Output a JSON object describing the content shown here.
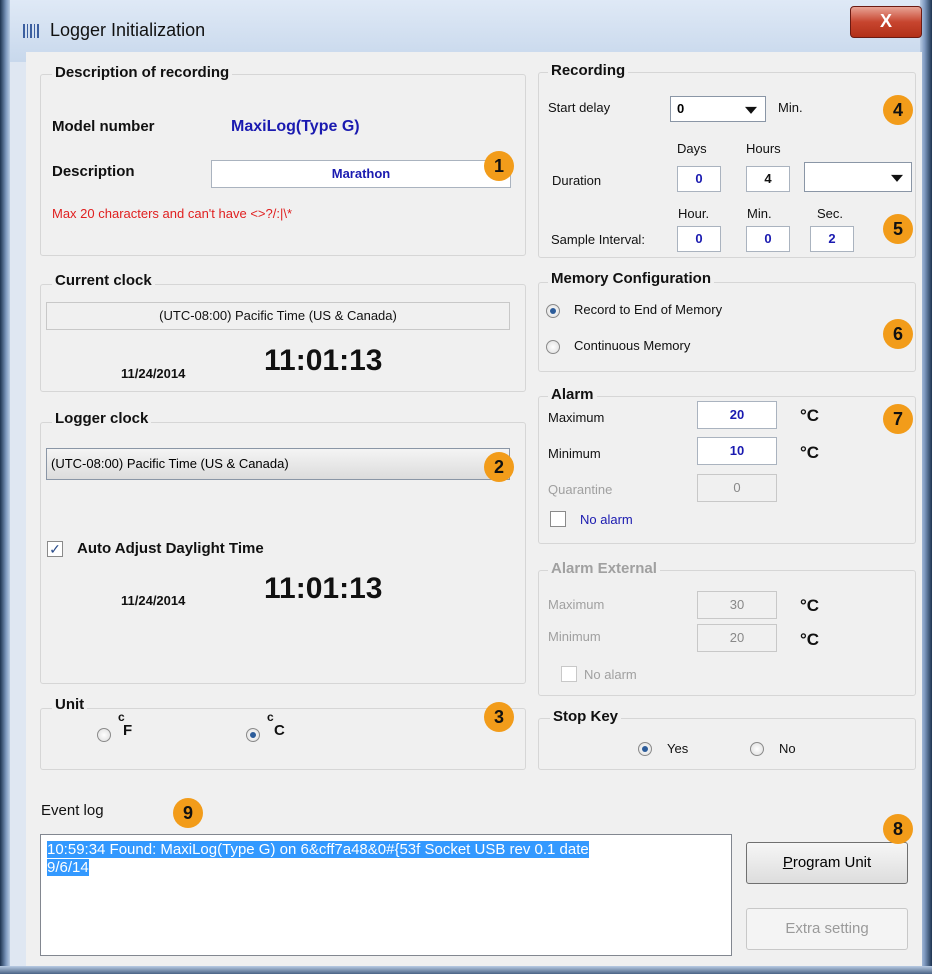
{
  "window": {
    "title": "Logger Initialization",
    "close_label": "X"
  },
  "desc": {
    "group_title": "Description of recording",
    "model_label": "Model number",
    "model_value": "MaxiLog(Type G)",
    "description_label": "Description",
    "description_value": "Marathon",
    "hint": "Max 20 characters and can't have <>?/:|\\*"
  },
  "current_clock": {
    "group_title": "Current clock",
    "timezone": "(UTC-08:00) Pacific Time (US & Canada)",
    "date": "11/24/2014",
    "time": "11:01:13"
  },
  "logger_clock": {
    "group_title": "Logger clock",
    "timezone": "(UTC-08:00) Pacific Time (US & Canada)",
    "auto_adjust_label": "Auto Adjust Daylight Time",
    "auto_adjust_checked": true,
    "date": "11/24/2014",
    "time": "11:01:13"
  },
  "unit": {
    "group_title": "Unit",
    "f_label": "F",
    "c_label": "C",
    "deg": "c",
    "selected": "C"
  },
  "recording": {
    "group_title": "Recording",
    "start_delay_label": "Start delay",
    "start_delay_value": "0",
    "start_delay_unit": "Min.",
    "duration_label": "Duration",
    "days_label": "Days",
    "hours_label": "Hours",
    "days_value": "0",
    "hours_value": "4",
    "duration_combo_value": "",
    "interval_label": "Sample Interval:",
    "hour_label": "Hour.",
    "min_label": "Min.",
    "sec_label": "Sec.",
    "hour_value": "0",
    "min_value": "0",
    "sec_value": "2"
  },
  "memory": {
    "group_title": "Memory Configuration",
    "option1": "Record to End of Memory",
    "option2": "Continuous Memory",
    "selected": 1
  },
  "alarm": {
    "group_title": "Alarm",
    "max_label": "Maximum",
    "max_value": "20",
    "min_label": "Minimum",
    "min_value": "10",
    "quarantine_label": "Quarantine",
    "quarantine_value": "0",
    "unit": "°C",
    "no_alarm_label": "No alarm"
  },
  "alarm_external": {
    "group_title": "Alarm External",
    "max_label": "Maximum",
    "max_value": "30",
    "min_label": "Minimum",
    "min_value": "20",
    "unit": "°C",
    "no_alarm_label": "No alarm"
  },
  "stop_key": {
    "group_title": "Stop Key",
    "yes_label": "Yes",
    "no_label": "No",
    "selected": "Yes"
  },
  "event_log": {
    "label": "Event log",
    "lines": [
      "10:59:34 Found: MaxiLog(Type G) on 6&cff7a48&0#{53f Socket USB  rev 0.1 date",
      "9/6/14"
    ]
  },
  "buttons": {
    "program_prefix": "P",
    "program_rest": "rogram Unit",
    "extra": "Extra setting"
  },
  "badges": [
    "1",
    "2",
    "3",
    "4",
    "5",
    "6",
    "7",
    "8",
    "9"
  ],
  "colors": {
    "accent_blue": "#1a1ab0",
    "hint_red": "#e02020",
    "badge": "#f29c1a",
    "selection": "#3399ff"
  }
}
